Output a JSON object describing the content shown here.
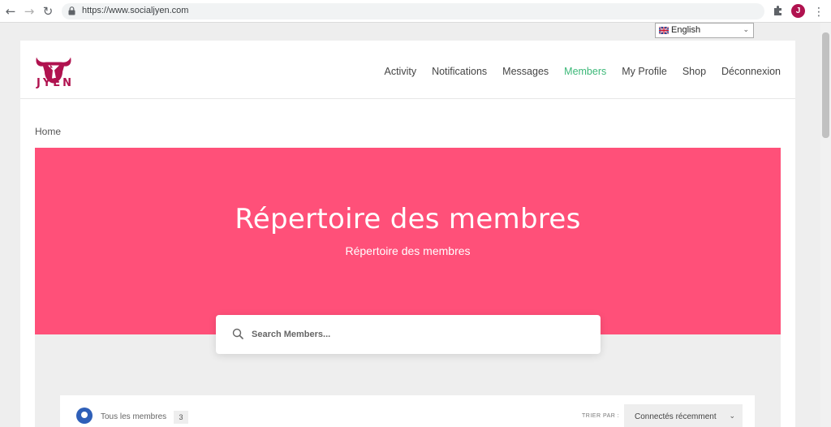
{
  "browser": {
    "url": "https://www.socialjyen.com",
    "profile_initial": "J"
  },
  "language": {
    "selected": "English"
  },
  "header": {
    "logo_text": "JYEN",
    "menu": [
      {
        "label": "Activity"
      },
      {
        "label": "Notifications"
      },
      {
        "label": "Messages"
      },
      {
        "label": "Members",
        "active": true
      },
      {
        "label": "My Profile"
      },
      {
        "label": "Shop"
      },
      {
        "label": "Déconnexion"
      }
    ]
  },
  "breadcrumb": "Home",
  "hero": {
    "title": "Répertoire des membres",
    "subtitle": "Répertoire des membres",
    "background": "#ff5079"
  },
  "search": {
    "placeholder": "Search Members..."
  },
  "members": {
    "tab_label": "Tous les membres",
    "count": "3",
    "sort_label": "TRIER PAR :",
    "sort_value": "Connectés récemment"
  },
  "colors": {
    "accent_active": "#3cb878",
    "brand": "#b0124f"
  }
}
